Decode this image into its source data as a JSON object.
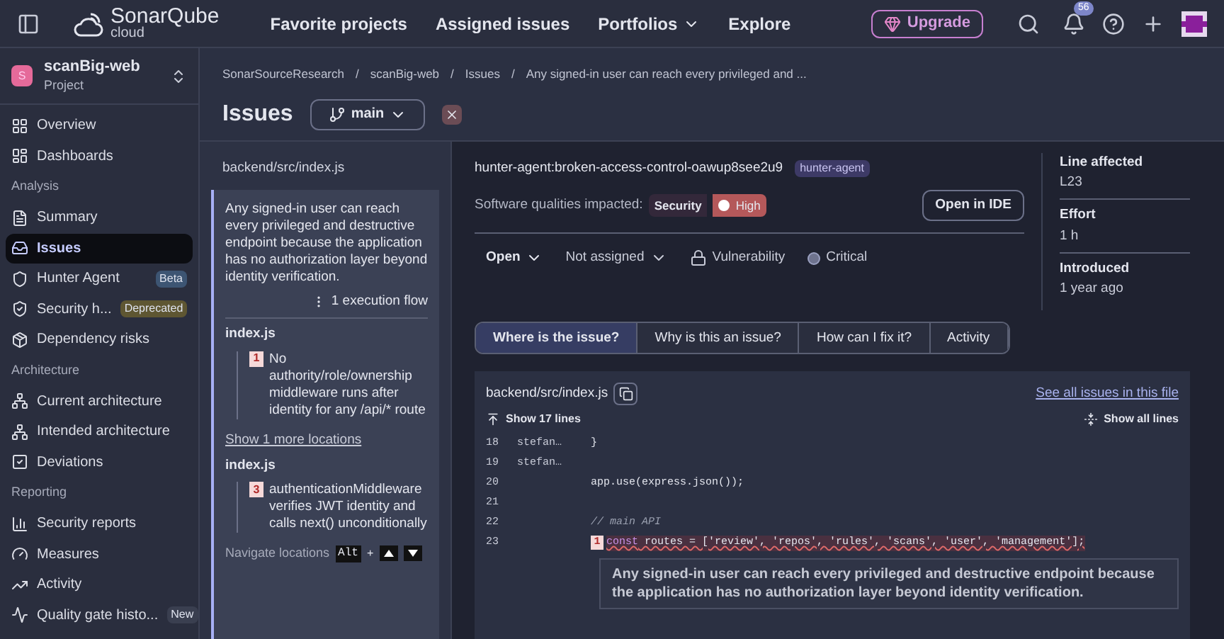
{
  "topbar": {
    "logo": {
      "name": "SonarQube",
      "sub": "cloud"
    },
    "nav": [
      {
        "label": "Favorite projects",
        "dropdown": false
      },
      {
        "label": "Assigned issues",
        "dropdown": false
      },
      {
        "label": "Portfolios",
        "dropdown": true
      },
      {
        "label": "Explore",
        "dropdown": false
      }
    ],
    "upgrade": "Upgrade",
    "notifications": "56"
  },
  "project": {
    "initial": "S",
    "name": "scanBig-web",
    "type": "Project"
  },
  "sidebar": [
    {
      "kind": "item",
      "label": "Overview",
      "selected": false
    },
    {
      "kind": "item",
      "label": "Dashboards",
      "selected": false
    },
    {
      "kind": "section",
      "label": "Analysis"
    },
    {
      "kind": "item",
      "label": "Summary",
      "selected": false
    },
    {
      "kind": "item",
      "label": "Issues",
      "selected": true
    },
    {
      "kind": "item",
      "label": "Hunter Agent",
      "selected": false,
      "badge": {
        "text": "Beta",
        "color": "#3d5573"
      }
    },
    {
      "kind": "item",
      "label": "Security h...",
      "selected": false,
      "badge": {
        "text": "Deprecated",
        "color": "#5e5632"
      }
    },
    {
      "kind": "item",
      "label": "Dependency risks",
      "selected": false
    },
    {
      "kind": "section",
      "label": "Architecture"
    },
    {
      "kind": "item",
      "label": "Current architecture",
      "selected": false
    },
    {
      "kind": "item",
      "label": "Intended architecture",
      "selected": false
    },
    {
      "kind": "item",
      "label": "Deviations",
      "selected": false
    },
    {
      "kind": "section",
      "label": "Reporting"
    },
    {
      "kind": "item",
      "label": "Security reports",
      "selected": false
    },
    {
      "kind": "item",
      "label": "Measures",
      "selected": false
    },
    {
      "kind": "item",
      "label": "Activity",
      "selected": false
    },
    {
      "kind": "item",
      "label": "Quality gate histo...",
      "selected": false,
      "badge": {
        "text": "New",
        "color": "#3a3f50"
      }
    }
  ],
  "breadcrumb": [
    {
      "label": "SonarSourceResearch"
    },
    {
      "separator": "/",
      "label": "scanBig-web"
    },
    {
      "separator": "/",
      "label": "Issues"
    },
    {
      "separator": "/",
      "label": "Any signed-in user can reach every privileged and ..."
    }
  ],
  "page_title": "Issues",
  "branch": "main",
  "issue_list": {
    "file": "backend/src/index.js",
    "message": "Any signed-in user can reach every privileged and destructive endpoint because the application has no authorization layer beyond identity verification.",
    "flow": "1 execution flow",
    "groups": [
      {
        "file": "index.js",
        "locations": [
          {
            "num": "1",
            "text": "No authority/role/ownership middleware runs after identity for any /api/* route"
          }
        ],
        "more": "Show 1 more locations"
      },
      {
        "file": "index.js",
        "locations": [
          {
            "num": "3",
            "text": "authenticationMiddleware verifies JWT identity and calls next() unconditionally"
          }
        ]
      }
    ],
    "navigate": "Navigate locations",
    "key": "Alt",
    "plus": "+"
  },
  "detail": {
    "rule": "hunter-agent:broken-access-control-oawup8see2u9",
    "tag": "hunter-agent",
    "qualities_label": "Software qualities impacted:",
    "quality": "Security",
    "severity": "High",
    "open_ide": "Open in IDE",
    "status": "Open",
    "assignee": "Not assigned",
    "type": "Vulnerability",
    "impact": "Critical",
    "meta": [
      {
        "label": "Line affected",
        "value": "L23"
      },
      {
        "label": "Effort",
        "value": "1 h"
      },
      {
        "label": "Introduced",
        "value": "1 year ago"
      }
    ],
    "tabs": [
      {
        "label": "Where is the issue?",
        "selected": true
      },
      {
        "label": "Why is this an issue?",
        "selected": false
      },
      {
        "label": "How can I fix it?",
        "selected": false
      },
      {
        "label": "Activity",
        "selected": false
      }
    ]
  },
  "code": {
    "file": "backend/src/index.js",
    "see_all": "See all issues in this file",
    "show_lines": "Show 17 lines",
    "show_all": "Show all lines",
    "lines": [
      {
        "num": "18",
        "author": "stefan…",
        "kind": "plain",
        "text": "}"
      },
      {
        "num": "19",
        "author": "stefan…",
        "kind": "plain"
      },
      {
        "num": "20",
        "kind": "plain",
        "text": "app.use(express.json());"
      },
      {
        "num": "21",
        "kind": "plain"
      },
      {
        "num": "22",
        "kind": "comment",
        "text": "// main API"
      },
      {
        "num": "23",
        "kind": "issue",
        "marker": "1",
        "keyword": "const",
        "text": " routes = ['review', 'repos', 'rules', 'scans', 'user', 'management'];"
      }
    ],
    "message": "Any signed-in user can reach every privileged and destructive endpoint because the application has no authorization layer beyond identity verification."
  }
}
